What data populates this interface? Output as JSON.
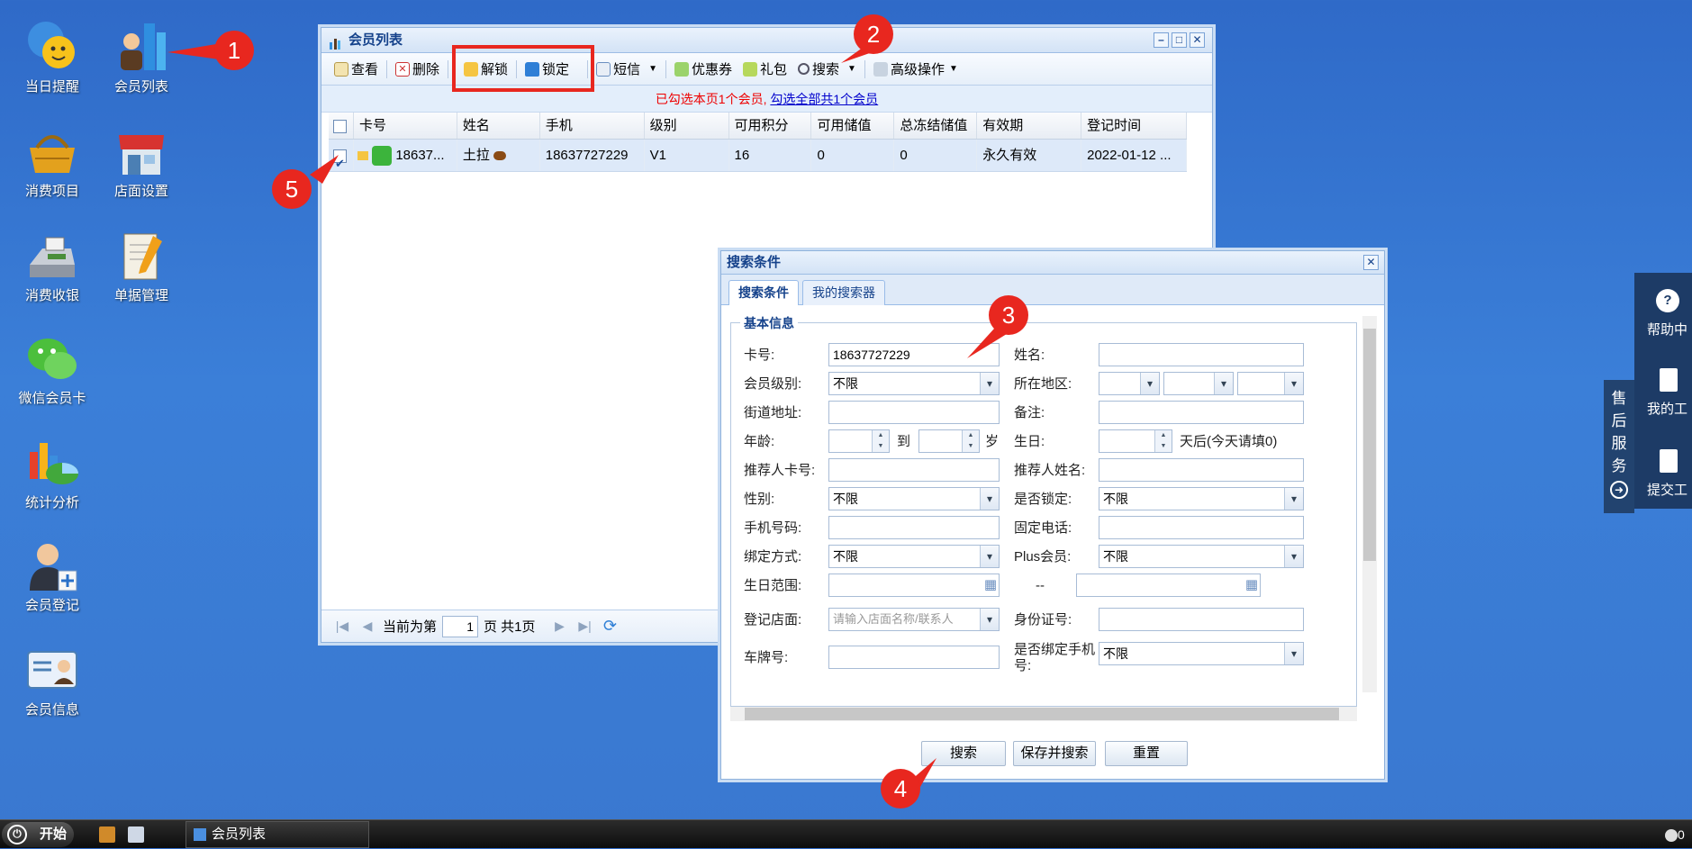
{
  "desktop": {
    "icons": [
      {
        "label": "当日提醒"
      },
      {
        "label": "会员列表"
      },
      {
        "label": "消费项目"
      },
      {
        "label": "店面设置"
      },
      {
        "label": "消费收银"
      },
      {
        "label": "单据管理"
      },
      {
        "label": "微信会员卡"
      },
      {
        "label": "统计分析"
      },
      {
        "label": "会员登记"
      },
      {
        "label": "会员信息"
      }
    ]
  },
  "callouts": [
    "1",
    "2",
    "3",
    "4",
    "5"
  ],
  "member_window": {
    "title": "会员列表",
    "toolbar": {
      "view": "查看",
      "delete": "删除",
      "unlock": "解锁",
      "lock": "锁定",
      "sms": "短信",
      "coupon": "优惠券",
      "gift": "礼包",
      "search": "搜索",
      "advanced": "高级操作"
    },
    "notice": {
      "selected": "已勾选本页1个会员,",
      "select_all": "勾选全部共1个会员"
    },
    "columns": [
      "卡号",
      "姓名",
      "手机",
      "级别",
      "可用积分",
      "可用储值",
      "总冻结储值",
      "有效期",
      "登记时间"
    ],
    "rows": [
      {
        "card": "18637...",
        "name": "土拉",
        "phone": "18637727229",
        "level": "V1",
        "points": "16",
        "balance": "0",
        "frozen": "0",
        "validity": "永久有效",
        "reg_time": "2022-01-12 ..."
      }
    ],
    "pager": {
      "current_prefix": "当前为第",
      "page": "1",
      "page_suffix": "页 共1页"
    }
  },
  "search_dialog": {
    "title": "搜索条件",
    "tabs": [
      "搜索条件",
      "我的搜索器"
    ],
    "section": "基本信息",
    "fields": {
      "card_label": "卡号:",
      "card_value": "18637727229",
      "name_label": "姓名:",
      "level_label": "会员级别:",
      "level_value": "不限",
      "region_label": "所在地区:",
      "street_label": "街道地址:",
      "remark_label": "备注:",
      "age_label": "年龄:",
      "age_to": "到",
      "age_unit": "岁",
      "birthday_label": "生日:",
      "birthday_suffix": "天后(今天请填0)",
      "ref_card_label": "推荐人卡号:",
      "ref_name_label": "推荐人姓名:",
      "gender_label": "性别:",
      "gender_value": "不限",
      "locked_label": "是否锁定:",
      "locked_value": "不限",
      "mobile_label": "手机号码:",
      "tel_label": "固定电话:",
      "bind_label": "绑定方式:",
      "bind_value": "不限",
      "plus_label": "Plus会员:",
      "plus_value": "不限",
      "bday_range_label": "生日范围:",
      "range_sep": "--",
      "store_label": "登记店面:",
      "store_placeholder": "请输入店面名称/联系人",
      "id_label": "身份证号:",
      "plate_label": "车牌号:",
      "bind_phone_label": "是否绑定手机号:",
      "bind_phone_value": "不限"
    },
    "buttons": {
      "search": "搜索",
      "save_search": "保存并搜索",
      "reset": "重置"
    }
  },
  "side_panel": {
    "tab_text": "售后服务",
    "items": [
      "帮助中",
      "我的工",
      "提交工"
    ]
  },
  "taskbar": {
    "start": "开始",
    "task": "会员列表",
    "clock": "0"
  },
  "colors": {
    "accent_red": "#e8271f",
    "title_blue": "#15428b",
    "desktop": "#3b7fd8"
  }
}
